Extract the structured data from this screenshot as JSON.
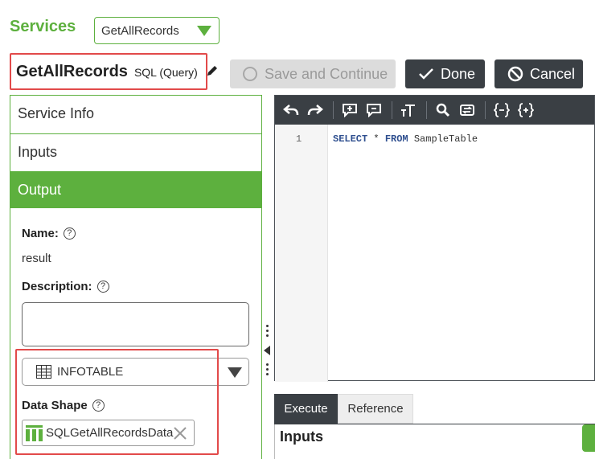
{
  "header": {
    "services_label": "Services",
    "service_selector_value": "GetAllRecords"
  },
  "title": {
    "service_name": "GetAllRecords",
    "service_type": "SQL (Query)"
  },
  "actions": {
    "save_label": "Save and Continue",
    "done_label": "Done",
    "cancel_label": "Cancel"
  },
  "nav": {
    "items": [
      {
        "label": "Service Info"
      },
      {
        "label": "Inputs"
      },
      {
        "label": "Output"
      }
    ]
  },
  "output": {
    "name_label": "Name:",
    "name_value": "result",
    "description_label": "Description:",
    "description_value": "",
    "base_type": "INFOTABLE",
    "data_shape_label": "Data Shape",
    "data_shape_value": "SQLGetAllRecordsData"
  },
  "editor": {
    "line_number": "1",
    "code_kw1": "SELECT",
    "code_mid": " * ",
    "code_kw2": "FROM",
    "code_rest": " SampleTable",
    "toolbar_icons": [
      "undo-icon",
      "redo-icon",
      "add-comment-icon",
      "remove-comment-icon",
      "text-size-icon",
      "search-icon",
      "replace-icon",
      "braces-collapse-icon",
      "braces-expand-icon"
    ]
  },
  "bottom": {
    "tabs": [
      "Execute",
      "Reference"
    ],
    "inputs_heading": "Inputs"
  },
  "colors": {
    "accent": "#5db03e",
    "dark": "#3a3f44",
    "highlight": "#e24a4a"
  }
}
